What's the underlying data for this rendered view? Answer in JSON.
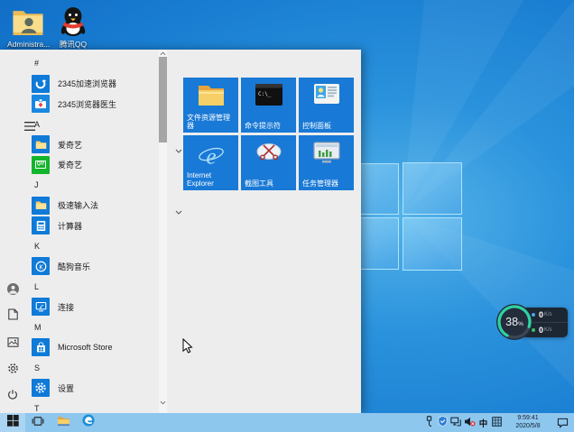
{
  "colors": {
    "accent_tile_blue": "#1979d6",
    "taskbar_blue": "#8ec7ee",
    "menu_background": "#ededed",
    "widget_arc_teal": "#2ed3a3",
    "upload_dot_blue": "#4aa3e8",
    "download_dot_green": "#35c06c"
  },
  "desktop": {
    "icons": [
      {
        "label": "Administra...",
        "icon": "admin-folder"
      },
      {
        "label": "腾讯QQ",
        "icon": "qq-penguin"
      }
    ]
  },
  "start_menu": {
    "rail_top": [
      {
        "name": "menu",
        "icon": "hamburger"
      }
    ],
    "rail_bottom": [
      {
        "name": "user",
        "icon": "user-avatar"
      },
      {
        "name": "documents",
        "icon": "documents"
      },
      {
        "name": "pictures",
        "icon": "pictures"
      },
      {
        "name": "settings",
        "icon": "settings-gear"
      },
      {
        "name": "power",
        "icon": "power"
      }
    ],
    "sections": [
      {
        "header": "#",
        "items": [
          {
            "label": "2345加速浏览器",
            "icon": "speed-browser"
          },
          {
            "label": "2345浏览器医生",
            "icon": "browser-doctor"
          }
        ]
      },
      {
        "header": "A",
        "items": [
          {
            "label": "爱奇艺",
            "icon": "folder-app",
            "expandable": true
          },
          {
            "label": "爱奇艺",
            "icon": "iqiyi",
            "logo_text": "QIY"
          }
        ]
      },
      {
        "header": "J",
        "items": [
          {
            "label": "极速输入法",
            "icon": "folder-app",
            "expandable": true
          },
          {
            "label": "计算器",
            "icon": "calculator"
          }
        ]
      },
      {
        "header": "K",
        "items": [
          {
            "label": "酷狗音乐",
            "icon": "kugou"
          }
        ]
      },
      {
        "header": "L",
        "items": [
          {
            "label": "连接",
            "icon": "connect"
          }
        ]
      },
      {
        "header": "M",
        "items": [
          {
            "label": "Microsoft Store",
            "icon": "ms-store"
          }
        ]
      },
      {
        "header": "S",
        "items": [
          {
            "label": "设置",
            "icon": "settings-tile"
          }
        ]
      },
      {
        "header": "T",
        "items": []
      }
    ],
    "tiles": [
      {
        "label": "文件资源管理器",
        "icon": "explorer-tile"
      },
      {
        "label": "命令提示符",
        "icon": "cmd-tile"
      },
      {
        "label": "控制面板",
        "icon": "control-panel-tile"
      },
      {
        "label": "Internet Explorer",
        "icon": "ie-tile"
      },
      {
        "label": "截图工具",
        "icon": "snipping-tile"
      },
      {
        "label": "任务管理器",
        "icon": "task-manager-tile"
      }
    ]
  },
  "speed_widget": {
    "percent": "38",
    "percent_unit": "%",
    "rows": [
      {
        "value": "0",
        "unit": "K/s",
        "dot": "#4aa3e8",
        "name": "upload-speed"
      },
      {
        "value": "0",
        "unit": "K/s",
        "dot": "#35c06c",
        "name": "download-speed"
      }
    ]
  },
  "taskbar": {
    "buttons": [
      {
        "name": "start",
        "icon": "start"
      },
      {
        "name": "task-view",
        "icon": "task-view"
      },
      {
        "name": "file-explorer",
        "icon": "explorer-small"
      },
      {
        "name": "edge-browser",
        "icon": "edge"
      }
    ],
    "tray": [
      {
        "name": "usb"
      },
      {
        "name": "security-shield"
      },
      {
        "name": "network"
      },
      {
        "name": "volume-muted"
      },
      {
        "name": "ime-language",
        "text": "中"
      },
      {
        "name": "ime-grid"
      }
    ],
    "clock": {
      "time": "9:59:41",
      "date": "2020/5/8"
    }
  }
}
